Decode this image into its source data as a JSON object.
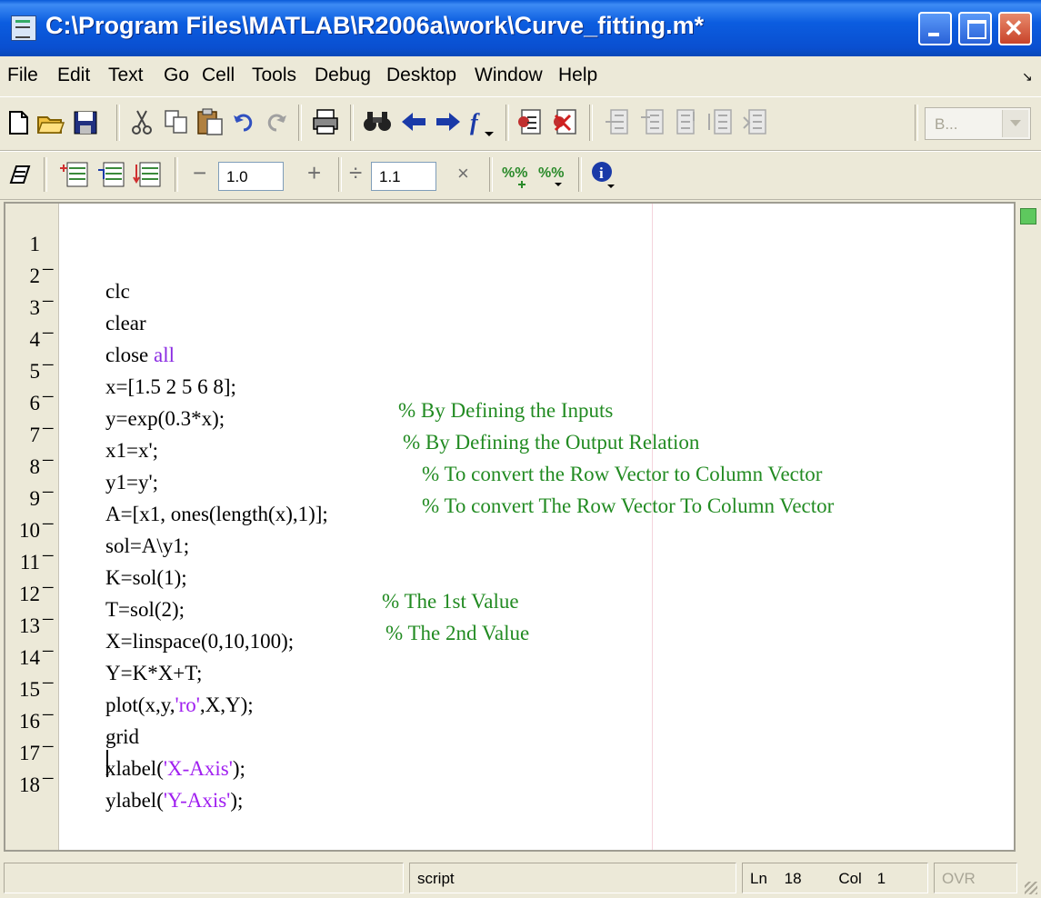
{
  "window": {
    "title": "C:\\Program Files\\MATLAB\\R2006a\\work\\Curve_fitting.m*"
  },
  "menu": [
    "File",
    "Edit",
    "Text",
    "Go",
    "Cell",
    "Tools",
    "Debug",
    "Desktop",
    "Window",
    "Help"
  ],
  "toolbar": {
    "stack_combo": "B...",
    "decrement_value": "1.0",
    "divide_value": "1.1"
  },
  "editor": {
    "lines": [
      {
        "n": "1",
        "bp": "–",
        "code": "clc",
        "comment": ""
      },
      {
        "n": "2",
        "bp": "–",
        "code": "clear",
        "comment": ""
      },
      {
        "n": "3",
        "bp": "–",
        "code": "close ",
        "kw": "all",
        "comment": ""
      },
      {
        "n": "4",
        "bp": "–",
        "code": "x=[1.5 2 5 6 8];",
        "comment": "% By Defining the Inputs"
      },
      {
        "n": "5",
        "bp": "–",
        "code": "y=exp(0.3*x);",
        "comment": "% By Defining the Output Relation"
      },
      {
        "n": "6",
        "bp": "–",
        "code": "x1=x';",
        "comment": "% To convert the Row Vector to Column Vector"
      },
      {
        "n": "7",
        "bp": "–",
        "code": "y1=y';",
        "comment": "% To convert The Row Vector To Column Vector"
      },
      {
        "n": "8",
        "bp": "–",
        "code": "A=[x1, ones(length(x),1)];",
        "comment": ""
      },
      {
        "n": "9",
        "bp": "–",
        "code": "sol=A\\y1;",
        "comment": ""
      },
      {
        "n": "10",
        "bp": "–",
        "code": "K=sol(1);",
        "comment": "% The 1st Value"
      },
      {
        "n": "11",
        "bp": "–",
        "code": "T=sol(2);",
        "comment": "% The 2nd Value"
      },
      {
        "n": "12",
        "bp": "–",
        "code": "X=linspace(0,10,100);",
        "comment": ""
      },
      {
        "n": "13",
        "bp": "–",
        "code": "Y=K*X+T;",
        "comment": ""
      },
      {
        "n": "14",
        "bp": "–",
        "code": "plot(x,y,",
        "str": "'ro'",
        "tail": ",X,Y);",
        "comment": ""
      },
      {
        "n": "15",
        "bp": "–",
        "code": "grid",
        "comment": ""
      },
      {
        "n": "16",
        "bp": "–",
        "code": "xlabel(",
        "str": "'X-Axis'",
        "tail": ");",
        "comment": ""
      },
      {
        "n": "17",
        "bp": "–",
        "code": "ylabel(",
        "str": "'Y-Axis'",
        "tail": ");",
        "comment": ""
      },
      {
        "n": "18",
        "bp": "",
        "code": "",
        "comment": ""
      }
    ]
  },
  "status": {
    "file_type": "script",
    "ln_label": "Ln",
    "ln_value": "18",
    "col_label": "Col",
    "col_value": "1",
    "ovr": "OVR"
  },
  "colors": {
    "comment": "#228b22",
    "keyword": "#8a2be2",
    "string": "#a020f0",
    "titlebar": "#0a5ad8"
  }
}
